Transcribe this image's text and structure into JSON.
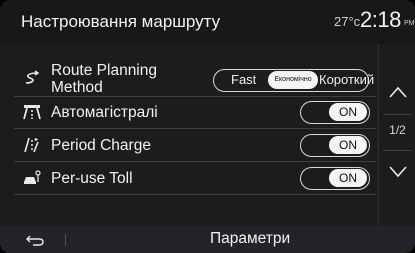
{
  "header": {
    "title": "Настроювання маршруту",
    "temperature": "27°c",
    "time": "2:18",
    "ampm": "PM"
  },
  "settings": [
    {
      "icon": "route-planning-icon",
      "label_line1": "Route Planning",
      "label_line2": "Method",
      "control": "segmented",
      "options": [
        "Fast",
        "Економічно",
        "Короткий"
      ],
      "selected": "Економічно"
    },
    {
      "icon": "highway-icon",
      "label": "Автомагістралі",
      "control": "toggle",
      "state": "ON"
    },
    {
      "icon": "period-charge-icon",
      "label": "Period Charge",
      "control": "toggle",
      "state": "ON"
    },
    {
      "icon": "per-use-toll-icon",
      "label": "Per-use Toll",
      "control": "toggle",
      "state": "ON"
    }
  ],
  "pager": {
    "indicator": "1/2"
  },
  "footer": {
    "title": "Параметри",
    "back_icon": "back-arrow-icon"
  }
}
